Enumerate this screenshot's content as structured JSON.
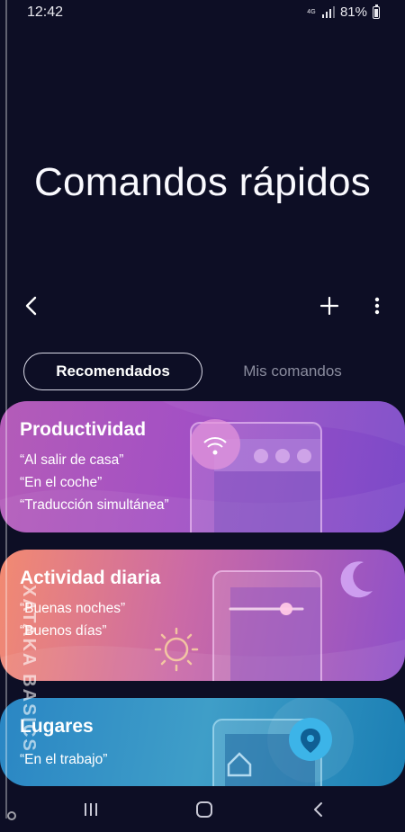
{
  "status_bar": {
    "time": "12:42",
    "network": "4G",
    "battery": "81%",
    "battery_level": 0.81
  },
  "header": {
    "title": "Comandos rápidos",
    "back_icon": "chevron-left-icon",
    "add_icon": "plus-icon",
    "more_icon": "more-vertical-icon"
  },
  "tabs": [
    {
      "label": "Recomendados",
      "selected": true
    },
    {
      "label": "Mis comandos",
      "selected": false
    }
  ],
  "cards": [
    {
      "title": "Productividad",
      "commands": [
        "“Al salir de casa”",
        "“En el coche”",
        "“Traducción simultánea”"
      ]
    },
    {
      "title": "Actividad diaria",
      "commands": [
        "“Buenas noches”",
        "“Buenos días”"
      ]
    },
    {
      "title": "Lugares",
      "commands": [
        "“En el trabajo”"
      ]
    }
  ],
  "watermark": {
    "text": "XATAKA BASICS"
  },
  "nav_bar": {
    "recents_icon": "recents-icon",
    "home_icon": "home-icon",
    "back_icon": "back-icon"
  },
  "colors": {
    "background": "#0d0e25",
    "card_productividad": "#a350c4",
    "card_actividad": "#cb6aa6",
    "card_lugares": "#2a86c4"
  }
}
